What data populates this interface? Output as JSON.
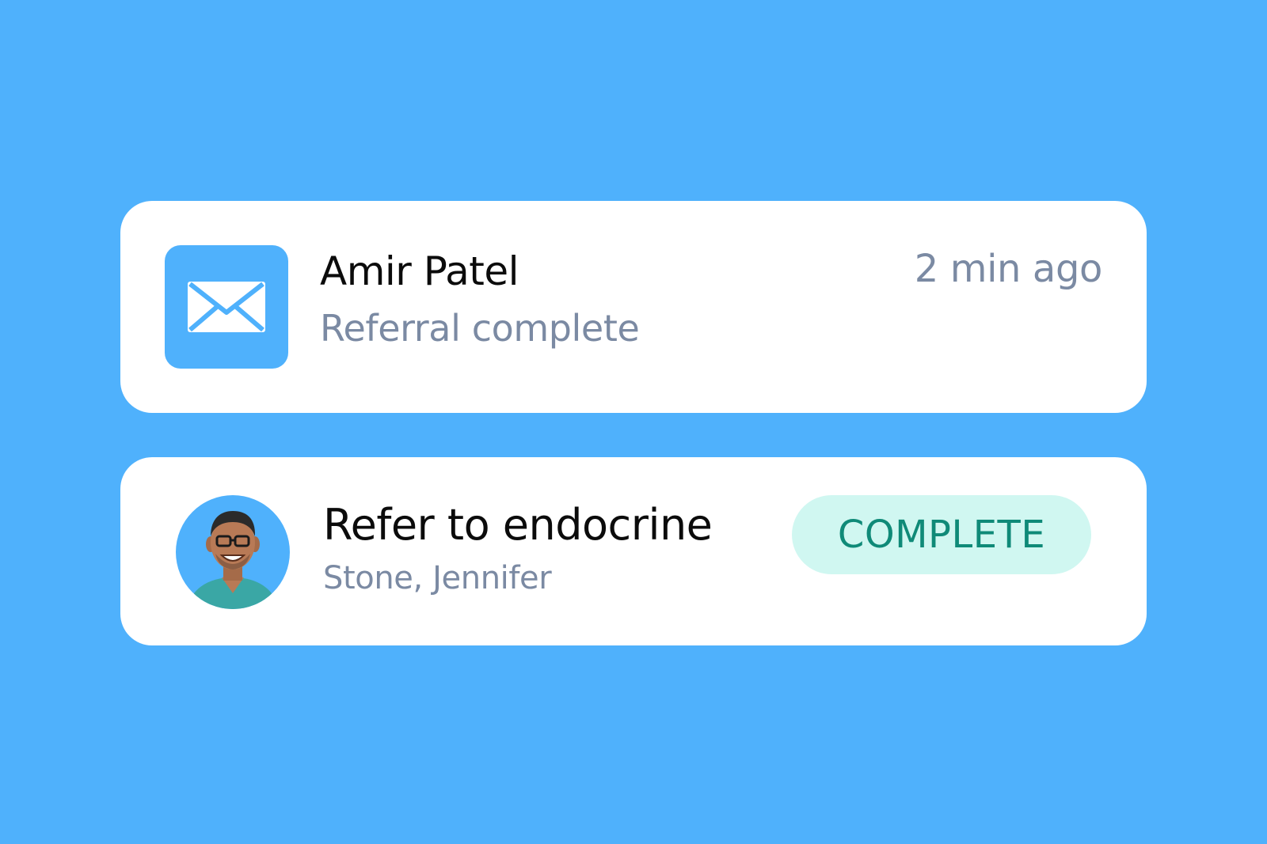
{
  "colors": {
    "background": "#4fb1fc",
    "card": "#ffffff",
    "accent": "#4fb1fc",
    "title_text": "#0b0b0b",
    "secondary_text": "#7b8aa3",
    "status_complete_bg": "#d0f7f1",
    "status_complete_text": "#0f8a78"
  },
  "message_notification": {
    "icon": "mail-icon",
    "sender": "Amir Patel",
    "message": "Referral complete",
    "time": "2 min ago"
  },
  "task_notification": {
    "avatar": "doctor-avatar",
    "title": "Refer to endocrine",
    "patient": "Stone, Jennifer",
    "status": "COMPLETE"
  }
}
